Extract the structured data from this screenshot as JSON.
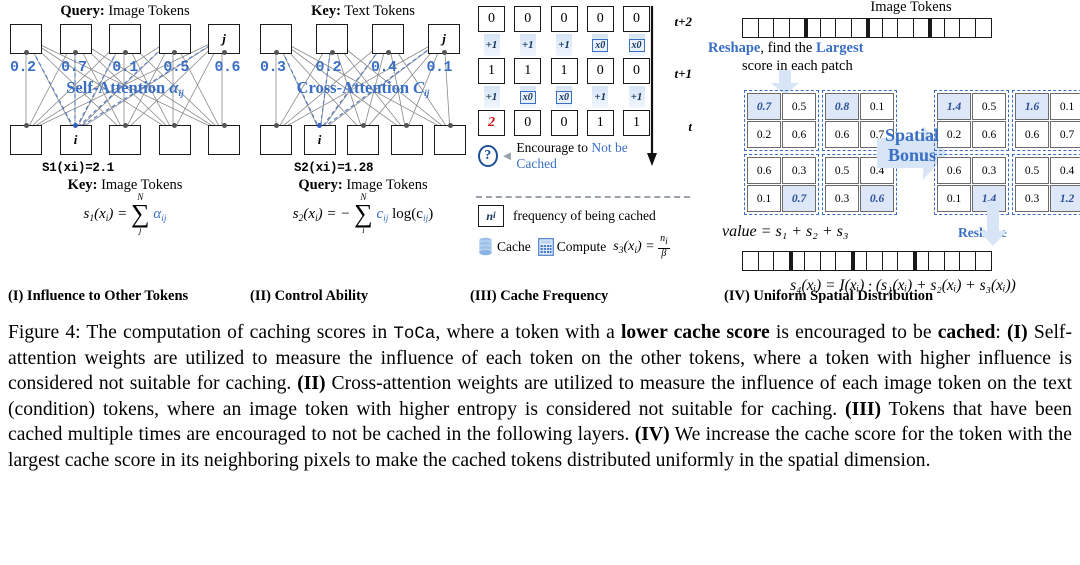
{
  "figure": {
    "panels": [
      {
        "id": "I",
        "caption": "(I) Influence to Other Tokens",
        "top_header_bold": "Query:",
        "top_header_rest": " Image Tokens",
        "bottom_header_bold": "Key:",
        "bottom_header_rest": " Image Tokens",
        "attention_label": "Self-Attention",
        "attention_symbol": "α",
        "attention_symbol_sub": "ij",
        "weights": [
          "0.2",
          "0.7",
          "0.1",
          "0.5",
          "0.6"
        ],
        "top_token_labels": [
          "",
          "",
          "",
          "",
          "j"
        ],
        "bottom_token_labels": [
          "",
          "i",
          "",
          "",
          ""
        ],
        "score_text": "S1(xi)=2.1",
        "formula": {
          "lhs": "s",
          "lhs_sub": "1",
          "lhs_arg": "(x",
          "lhs_arg_sub": "i",
          "lhs_arg_close": ")",
          "eq": "=",
          "sum_upper": "N",
          "sum_lower": "j",
          "term": "α",
          "term_sub": "ij",
          "minus": ""
        }
      },
      {
        "id": "II",
        "caption": "(II) Control Ability",
        "top_header_bold": "Key:",
        "top_header_rest": " Text Tokens",
        "bottom_header_bold": "Query:",
        "bottom_header_rest": " Image Tokens",
        "attention_label": "Cross-Attention",
        "attention_symbol": "C",
        "attention_symbol_sub": "ij",
        "weights": [
          "0.3",
          "0.2",
          "0.4",
          "0.1"
        ],
        "top_token_labels": [
          "",
          "",
          "",
          "j"
        ],
        "bottom_token_labels": [
          "",
          "i",
          "",
          "",
          ""
        ],
        "score_text": "S2(xi)=1.28",
        "formula": {
          "lhs": "s",
          "lhs_sub": "2",
          "lhs_arg": "(x",
          "lhs_arg_sub": "i",
          "lhs_arg_close": ")",
          "eq": "=",
          "minus": "−",
          "sum_upper": "N",
          "sum_lower": "i",
          "term": "c",
          "term_sub": "ij",
          "tail": "log(c",
          "tail_sub": "ij",
          "tail_close": ")"
        }
      }
    ],
    "panel3": {
      "caption": "(III) Cache Frequency",
      "rows": [
        {
          "timestep": "t+2",
          "values": [
            "0",
            "0",
            "0",
            "0",
            "0"
          ]
        },
        {
          "timestep": "t+1",
          "values": [
            "1",
            "1",
            "1",
            "0",
            "0"
          ]
        },
        {
          "timestep": "t",
          "values": [
            "2",
            "0",
            "0",
            "1",
            "1"
          ],
          "highlight_index": 0
        }
      ],
      "ops_upper": [
        "+1",
        "+1",
        "+1",
        "x0",
        "x0"
      ],
      "ops_upper_kind": [
        "plus",
        "plus",
        "plus",
        "compute",
        "compute"
      ],
      "ops_lower": [
        "+1",
        "x0",
        "x0",
        "+1",
        "+1"
      ],
      "ops_lower_kind": [
        "plus",
        "compute",
        "compute",
        "plus",
        "plus"
      ],
      "encourage_prefix": "Encourage to ",
      "encourage_highlight": "Not be Cached",
      "legend_box_symbol": "n",
      "legend_box_sub": "i",
      "legend_freq_text": "frequency of being cached",
      "legend_cache": "Cache",
      "legend_compute": "Compute",
      "legend_formula_lhs": "s",
      "legend_formula_lhs_sub": "3",
      "legend_formula_arg": "(x",
      "legend_formula_arg_sub": "i",
      "legend_formula_arg_close": ")",
      "legend_formula_eq": "=",
      "legend_formula_num": "n",
      "legend_formula_num_sub": "i",
      "legend_formula_den": "β"
    },
    "panel4": {
      "caption": "(IV) Uniform Spatial Distribution",
      "title": "Image Tokens",
      "top_strip_count": 16,
      "top_strip_thick_after": [
        4,
        8,
        12
      ],
      "bottom_strip_count": 16,
      "bottom_strip_thick_after": [
        3,
        7,
        11
      ],
      "reshape_line1_a": "Reshape",
      "reshape_line1_b": ", find the ",
      "reshape_line1_c": "Largest",
      "reshape_line2": "score in each patch",
      "spatial_bonus_line1": "Spatial",
      "spatial_bonus_line2": "Bonus",
      "reshape_label": "Reshape",
      "left_grid": [
        [
          "0.7",
          "0.5",
          "0.8",
          "0.1"
        ],
        [
          "0.2",
          "0.6",
          "0.6",
          "0.7"
        ],
        [
          "0.6",
          "0.3",
          "0.5",
          "0.4"
        ],
        [
          "0.1",
          "0.7",
          "0.3",
          "0.6"
        ]
      ],
      "left_grid_highlight": [
        [
          true,
          false,
          true,
          false
        ],
        [
          false,
          false,
          false,
          false
        ],
        [
          false,
          false,
          false,
          false
        ],
        [
          false,
          true,
          false,
          true
        ]
      ],
      "right_grid": [
        [
          "1.4",
          "0.5",
          "1.6",
          "0.1"
        ],
        [
          "0.2",
          "0.6",
          "0.6",
          "0.7"
        ],
        [
          "0.6",
          "0.3",
          "0.5",
          "0.4"
        ],
        [
          "0.1",
          "1.4",
          "0.3",
          "1.2"
        ]
      ],
      "right_grid_highlight": [
        [
          true,
          false,
          true,
          false
        ],
        [
          false,
          false,
          false,
          false
        ],
        [
          false,
          false,
          false,
          false
        ],
        [
          false,
          true,
          false,
          true
        ]
      ],
      "value_formula": "value = s₁ + s₂ + s₃",
      "s4_formula": "s₄(xᵢ) = I(xᵢ) · (s₁(xᵢ) + s₂(xᵢ) + s₃(xᵢ))",
      "timesteps": [
        "t+2",
        "t+1",
        "t"
      ]
    },
    "caption_parts": {
      "p1": "Figure 4: The computation of caching scores in ",
      "mono1": "ToCa",
      "p2": ", where a token with a ",
      "b1": "lower cache score",
      "p3": " is encouraged to be ",
      "b2": "cached",
      "p4": ": ",
      "b3": "(I)",
      "p5": " Self-attention weights are utilized to measure the influence of each token on the other tokens, where a token with higher influence is considered not suitable for caching. ",
      "b4": "(II)",
      "p6": " Cross-attention weights are utilized to measure the influence of each image token on the text (condition) tokens, where an image token with higher entropy is considered not suitable for caching. ",
      "b5": "(III)",
      "p7": " Tokens that have been cached multiple times are encouraged to not be cached in the following layers. ",
      "b6": "(IV)",
      "p8": " We increase the cache score for the token with the largest cache score in its neighboring pixels to make the cached tokens distributed uniformly in the spatial dimension."
    },
    "colors": {
      "accent_blue": "#3a6fc4",
      "deep_blue": "#1d4f9c",
      "red": "#cc1111",
      "highlight_fill": "#dde7f7",
      "ink": "#1a1a1a"
    }
  }
}
